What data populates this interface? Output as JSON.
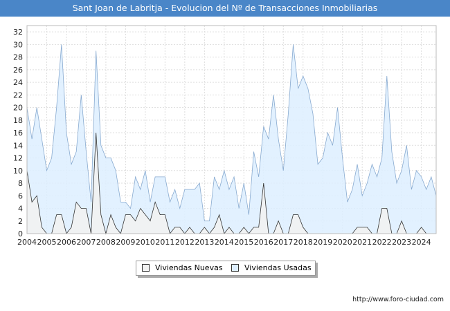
{
  "chart_data": {
    "type": "area",
    "title": "Sant Joan de Labritja - Evolucion del Nº de Transacciones Inmobiliarias",
    "xlabel": "",
    "ylabel": "",
    "ylim": [
      0,
      33
    ],
    "yticks": [
      0,
      2,
      4,
      6,
      8,
      10,
      12,
      14,
      16,
      18,
      20,
      22,
      24,
      26,
      28,
      30,
      32
    ],
    "xlim": [
      2004,
      2024.75
    ],
    "year_labels": [
      "2004",
      "2005",
      "2006",
      "2007",
      "2008",
      "2009",
      "2010",
      "2011",
      "2012",
      "2013",
      "2014",
      "2015",
      "2016",
      "2017",
      "2018",
      "2019",
      "2020",
      "2021",
      "2022",
      "2023",
      "2024"
    ],
    "x_step": 0.25,
    "grid": true,
    "legend_position": "bottom",
    "series": [
      {
        "name": "Viviendas Nuevas",
        "color": "#f2f2f2",
        "line_color": "#333333",
        "values": [
          10,
          5,
          6,
          1,
          0,
          0,
          3,
          3,
          0,
          1,
          5,
          4,
          4,
          0,
          16,
          3,
          0,
          3,
          1,
          0,
          3,
          3,
          2,
          4,
          3,
          2,
          5,
          3,
          3,
          0,
          1,
          1,
          0,
          1,
          0,
          0,
          1,
          0,
          1,
          3,
          0,
          1,
          0,
          0,
          1,
          0,
          1,
          1,
          8,
          0,
          0,
          2,
          0,
          0,
          3,
          3,
          1,
          0,
          0,
          0,
          0,
          0,
          0,
          0,
          0,
          0,
          0,
          1,
          1,
          1,
          0,
          0,
          4,
          4,
          0,
          0,
          2,
          0,
          0,
          0,
          1,
          0,
          0
        ]
      },
      {
        "name": "Viviendas Usadas",
        "color": "#ddeeff",
        "line_color": "#88aad0",
        "values": [
          20,
          15,
          20,
          15,
          10,
          12,
          20,
          30,
          16,
          11,
          13,
          22,
          13,
          5,
          29,
          14,
          12,
          12,
          10,
          5,
          5,
          4,
          9,
          7,
          10,
          5,
          9,
          9,
          9,
          5,
          7,
          4,
          7,
          7,
          7,
          8,
          2,
          2,
          9,
          7,
          10,
          7,
          9,
          4,
          8,
          3,
          13,
          9,
          17,
          15,
          22,
          15,
          10,
          19,
          30,
          23,
          25,
          23,
          19,
          11,
          12,
          16,
          14,
          20,
          12,
          5,
          7,
          11,
          6,
          8,
          11,
          9,
          12,
          25,
          13,
          8,
          10,
          14,
          7,
          10,
          9,
          7,
          9,
          6
        ]
      }
    ]
  },
  "legend": {
    "item1": "Viviendas Nuevas",
    "item2": "Viviendas Usadas"
  },
  "footer": {
    "url": "http://www.foro-ciudad.com"
  }
}
